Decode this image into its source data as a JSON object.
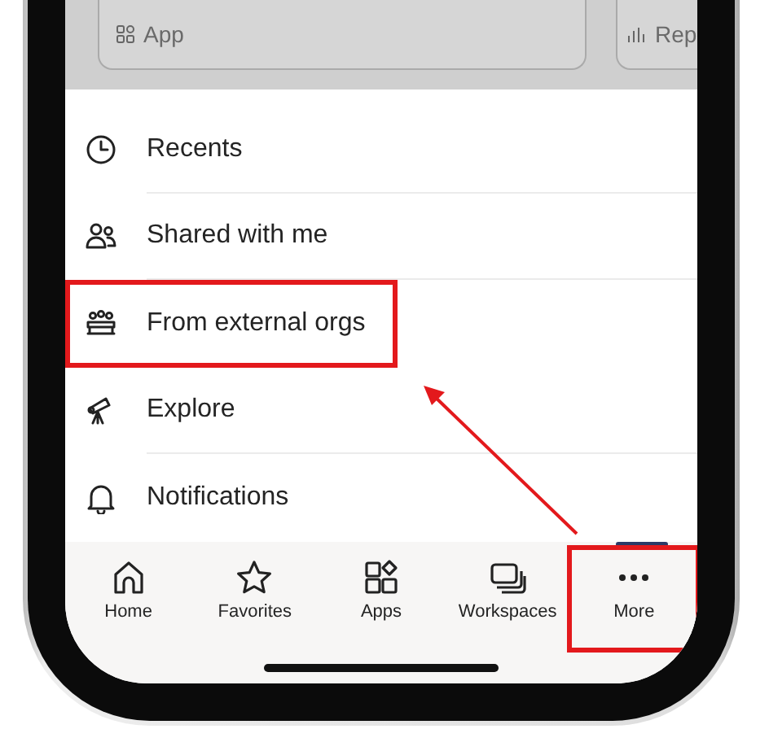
{
  "top_cards": [
    {
      "label": "App",
      "kind": "app"
    },
    {
      "label": "Rep",
      "kind": "report"
    }
  ],
  "menu": [
    {
      "label": "Recents",
      "kind": "recents",
      "highlighted": false
    },
    {
      "label": "Shared with me",
      "kind": "shared",
      "highlighted": false
    },
    {
      "label": "From external orgs",
      "kind": "external",
      "highlighted": true
    },
    {
      "label": "Explore",
      "kind": "explore",
      "highlighted": false
    },
    {
      "label": "Notifications",
      "kind": "notifications",
      "highlighted": false
    }
  ],
  "tabs": [
    {
      "label": "Home",
      "kind": "home",
      "highlighted": false
    },
    {
      "label": "Favorites",
      "kind": "favorites",
      "highlighted": false
    },
    {
      "label": "Apps",
      "kind": "apps",
      "highlighted": false
    },
    {
      "label": "Workspaces",
      "kind": "workspaces",
      "highlighted": false
    },
    {
      "label": "More",
      "kind": "more",
      "highlighted": true
    }
  ]
}
